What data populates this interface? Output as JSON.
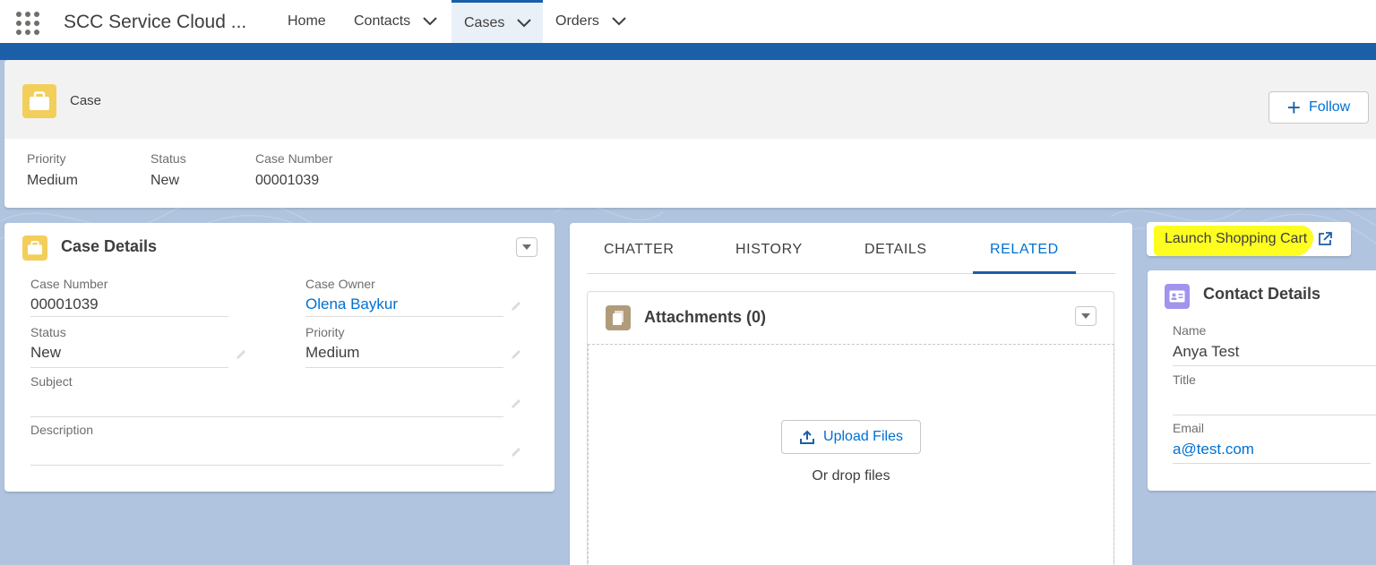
{
  "app": {
    "name": "SCC Service Cloud ...",
    "nav": [
      {
        "label": "Home",
        "has_menu": false,
        "active": false
      },
      {
        "label": "Contacts",
        "has_menu": true,
        "active": false
      },
      {
        "label": "Cases",
        "has_menu": true,
        "active": true
      },
      {
        "label": "Orders",
        "has_menu": true,
        "active": false
      }
    ]
  },
  "header": {
    "object_label": "Case",
    "follow_label": "Follow",
    "highlights": [
      {
        "label": "Priority",
        "value": "Medium"
      },
      {
        "label": "Status",
        "value": "New"
      },
      {
        "label": "Case Number",
        "value": "00001039"
      }
    ]
  },
  "case_details": {
    "title": "Case Details",
    "fields": {
      "case_number": {
        "label": "Case Number",
        "value": "00001039"
      },
      "case_owner": {
        "label": "Case Owner",
        "value": "Olena Baykur"
      },
      "status": {
        "label": "Status",
        "value": "New"
      },
      "priority": {
        "label": "Priority",
        "value": "Medium"
      },
      "subject": {
        "label": "Subject",
        "value": ""
      },
      "description": {
        "label": "Description",
        "value": ""
      }
    }
  },
  "tabs": [
    {
      "label": "CHATTER",
      "active": false
    },
    {
      "label": "HISTORY",
      "active": false
    },
    {
      "label": "DETAILS",
      "active": false
    },
    {
      "label": "RELATED",
      "active": true
    }
  ],
  "attachments": {
    "title": "Attachments (0)",
    "upload_label": "Upload Files",
    "drop_label": "Or drop files"
  },
  "launch": {
    "label": "Launch Shopping Cart",
    "highlight_color": "#fdfd1f"
  },
  "contact_details": {
    "title": "Contact Details",
    "fields": {
      "name": {
        "label": "Name",
        "value": "Anya Test"
      },
      "title": {
        "label": "Title",
        "value": ""
      },
      "email": {
        "label": "Email",
        "value": "a@test.com"
      }
    }
  },
  "colors": {
    "brand": "#1b5fa8",
    "link": "#0070d2",
    "case_icon": "#f2cf5b",
    "contact_icon": "#a094ed",
    "attachment_icon": "#b09c7b",
    "page_background": "#b0c4df"
  }
}
